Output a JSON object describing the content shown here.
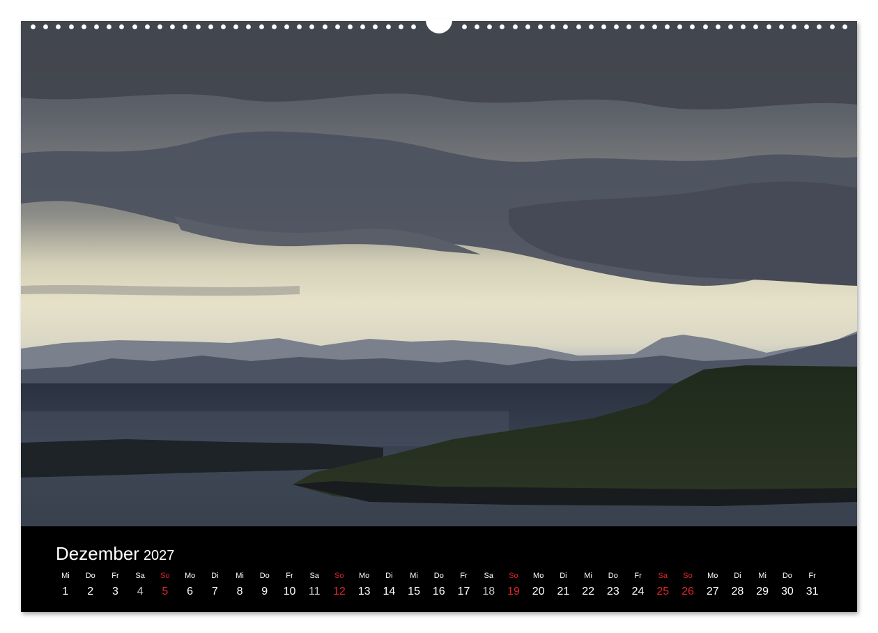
{
  "calendar": {
    "month": "Dezember",
    "year": "2027",
    "days": [
      {
        "wd": "Mi",
        "num": "1",
        "type": "normal"
      },
      {
        "wd": "Do",
        "num": "2",
        "type": "normal"
      },
      {
        "wd": "Fr",
        "num": "3",
        "type": "normal"
      },
      {
        "wd": "Sa",
        "num": "4",
        "type": "sat"
      },
      {
        "wd": "So",
        "num": "5",
        "type": "red"
      },
      {
        "wd": "Mo",
        "num": "6",
        "type": "normal"
      },
      {
        "wd": "Di",
        "num": "7",
        "type": "normal"
      },
      {
        "wd": "Mi",
        "num": "8",
        "type": "normal"
      },
      {
        "wd": "Do",
        "num": "9",
        "type": "normal"
      },
      {
        "wd": "Fr",
        "num": "10",
        "type": "normal"
      },
      {
        "wd": "Sa",
        "num": "11",
        "type": "sat"
      },
      {
        "wd": "So",
        "num": "12",
        "type": "red"
      },
      {
        "wd": "Mo",
        "num": "13",
        "type": "normal"
      },
      {
        "wd": "Di",
        "num": "14",
        "type": "normal"
      },
      {
        "wd": "Mi",
        "num": "15",
        "type": "normal"
      },
      {
        "wd": "Do",
        "num": "16",
        "type": "normal"
      },
      {
        "wd": "Fr",
        "num": "17",
        "type": "normal"
      },
      {
        "wd": "Sa",
        "num": "18",
        "type": "sat"
      },
      {
        "wd": "So",
        "num": "19",
        "type": "red"
      },
      {
        "wd": "Mo",
        "num": "20",
        "type": "normal"
      },
      {
        "wd": "Di",
        "num": "21",
        "type": "normal"
      },
      {
        "wd": "Mi",
        "num": "22",
        "type": "normal"
      },
      {
        "wd": "Do",
        "num": "23",
        "type": "normal"
      },
      {
        "wd": "Fr",
        "num": "24",
        "type": "normal"
      },
      {
        "wd": "Sa",
        "num": "25",
        "type": "red"
      },
      {
        "wd": "So",
        "num": "26",
        "type": "red"
      },
      {
        "wd": "Mo",
        "num": "27",
        "type": "normal"
      },
      {
        "wd": "Di",
        "num": "28",
        "type": "normal"
      },
      {
        "wd": "Mi",
        "num": "29",
        "type": "normal"
      },
      {
        "wd": "Do",
        "num": "30",
        "type": "normal"
      },
      {
        "wd": "Fr",
        "num": "31",
        "type": "normal"
      }
    ]
  },
  "colors": {
    "holiday_red": "#e0232b",
    "bar_background": "#000000",
    "text": "#ffffff"
  }
}
